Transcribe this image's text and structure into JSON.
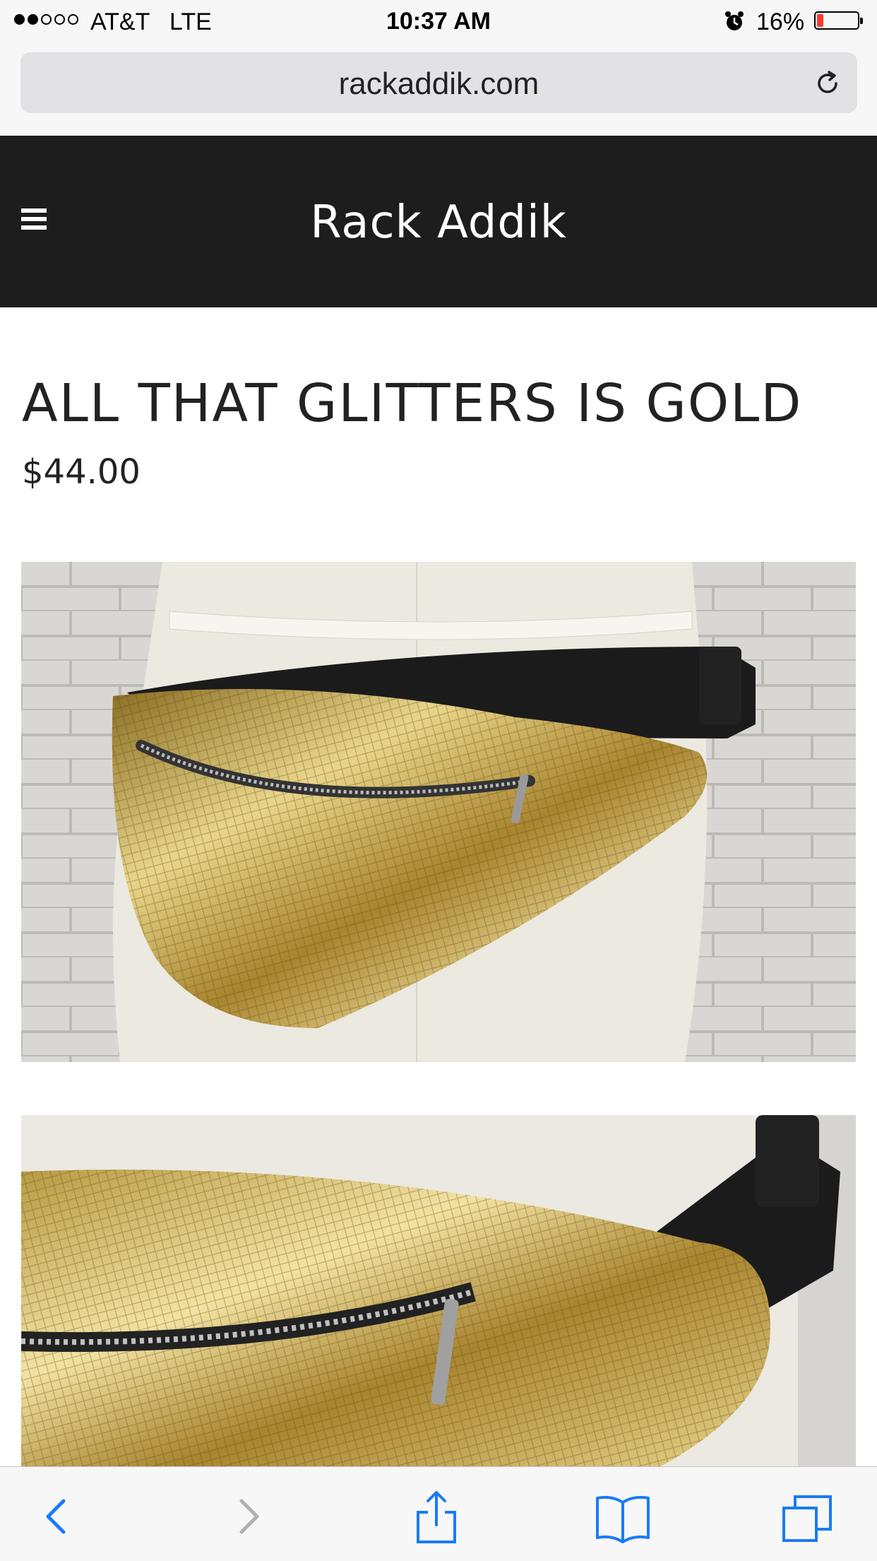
{
  "status_bar": {
    "carrier": "AT&T",
    "network": "LTE",
    "time": "10:37 AM",
    "battery": "16%",
    "battery_level": 0.16,
    "signal_bars_filled": 2,
    "signal_bars_total": 5
  },
  "browser": {
    "url": "rackaddik.com"
  },
  "site": {
    "title": "Rack Addik"
  },
  "product": {
    "title": "ALL THAT GLITTERS IS GOLD",
    "price": "$44.00"
  },
  "colors": {
    "header_bg": "#1d1d1d",
    "ios_blue": "#1a7bf6",
    "battery_low": "#ff3b30",
    "gold": "#c9a94a"
  },
  "icons": {
    "menu": "hamburger-icon",
    "reload": "reload-icon",
    "back": "chevron-left-icon",
    "forward": "chevron-right-icon",
    "share": "share-icon",
    "bookmarks": "book-icon",
    "tabs": "tabs-icon"
  }
}
